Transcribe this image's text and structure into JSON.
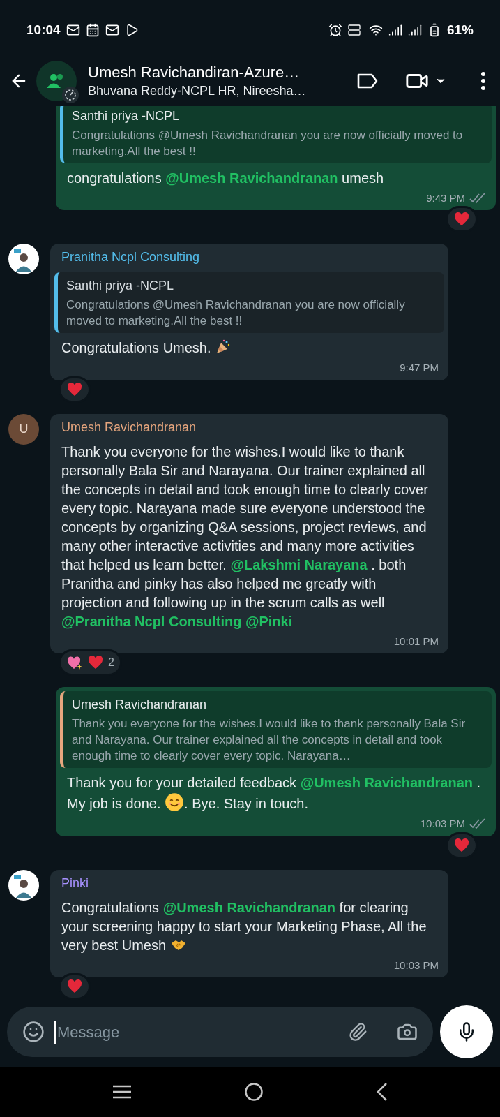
{
  "status_bar": {
    "time": "10:04",
    "battery": "61%"
  },
  "header": {
    "title": "Umesh Ravichandiran-Azure…",
    "subtitle": "Bhuvana Reddy-NCPL HR, Nireesha…"
  },
  "messages": [
    {
      "kind": "outgoing",
      "quote": {
        "author": "Santhi priya -NCPL",
        "color": "#53bdeb",
        "text": "Congratulations @Umesh Ravichandranan you are now officially moved to marketing.All the best !!"
      },
      "parts": [
        {
          "kind": "text",
          "text": "congratulations "
        },
        {
          "kind": "mention",
          "text": "@Umesh Ravichandranan"
        },
        {
          "kind": "text",
          "text": " umesh"
        }
      ],
      "time": "9:43 PM",
      "read": false,
      "reactions": [
        {
          "kind": "heart"
        }
      ]
    },
    {
      "kind": "incoming",
      "avatar": {
        "kind": "photo"
      },
      "sender": "Pranitha Ncpl Consulting",
      "color": "#53bdeb",
      "quote": {
        "author": "Santhi priya -NCPL",
        "color": "#53bdeb",
        "text": "Congratulations @Umesh Ravichandranan you are now officially moved to marketing.All the best !!"
      },
      "parts": [
        {
          "kind": "text",
          "text": "Congratulations Umesh. "
        },
        {
          "kind": "party"
        }
      ],
      "time": "9:47 PM",
      "reactions": [
        {
          "kind": "heart"
        }
      ]
    },
    {
      "kind": "incoming",
      "avatar": {
        "kind": "letter",
        "initial": "U"
      },
      "sender": "Umesh Ravichandranan",
      "color": "#e6a67e",
      "parts": [
        {
          "kind": "text",
          "text": "Thank you everyone for the wishes.I would like to thank personally Bala Sir and Narayana. Our trainer explained all the concepts in detail and took enough time to clearly cover every topic. Narayana made sure everyone understood the concepts by organizing Q&A sessions, project reviews, and many other interactive activities and many more activities that helped us learn better. "
        },
        {
          "kind": "mention",
          "text": "@Lakshmi Narayana"
        },
        {
          "kind": "text",
          "text": " . both Pranitha and pinky has also helped me greatly with projection and following up in the scrum calls as well "
        },
        {
          "kind": "mention",
          "text": "@Pranitha Ncpl Consulting @Pinki"
        }
      ],
      "time": "10:01 PM",
      "reactions": [
        {
          "kind": "sparkling-heart"
        },
        {
          "kind": "heart"
        }
      ],
      "reaction_count": "2"
    },
    {
      "kind": "outgoing",
      "quote": {
        "author": "Umesh Ravichandranan",
        "color": "#e6a67e",
        "text": "Thank you everyone for the wishes.I would like to thank personally Bala Sir and Narayana. Our trainer explained all the concepts in detail and took enough time to clearly cover every topic. Narayana…"
      },
      "parts": [
        {
          "kind": "text",
          "text": "Thank you for your detailed feedback "
        },
        {
          "kind": "mention",
          "text": "@Umesh Ravichandranan"
        },
        {
          "kind": "text",
          "text": " . My job is done. "
        },
        {
          "kind": "smile"
        },
        {
          "kind": "text",
          "text": ". Bye. Stay in touch."
        }
      ],
      "time": "10:03 PM",
      "read": false,
      "reactions": [
        {
          "kind": "heart"
        }
      ]
    },
    {
      "kind": "incoming",
      "avatar": {
        "kind": "photo"
      },
      "sender": "Pinki",
      "color": "#a791ff",
      "parts": [
        {
          "kind": "text",
          "text": "Congratulations "
        },
        {
          "kind": "mention",
          "text": "@Umesh Ravichandranan"
        },
        {
          "kind": "text",
          "text": " for clearing your screening happy to start your Marketing Phase, All the very best Umesh "
        },
        {
          "kind": "handshake"
        }
      ],
      "time": "10:03 PM",
      "reactions": [
        {
          "kind": "heart"
        }
      ]
    }
  ],
  "composer": {
    "placeholder": "Message"
  }
}
